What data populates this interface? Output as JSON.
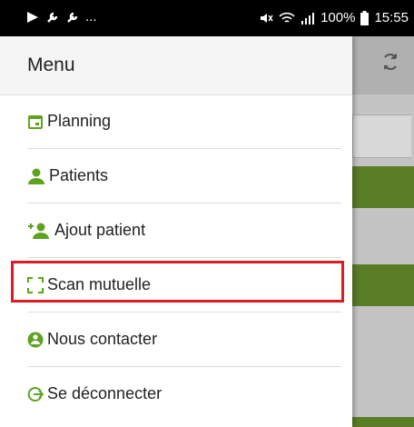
{
  "status_bar": {
    "time": "15:55",
    "battery": "100%",
    "left_overflow": "..."
  },
  "drawer": {
    "title": "Menu",
    "items": [
      {
        "label": "Planning",
        "icon": "calendar-icon"
      },
      {
        "label": "Patients",
        "icon": "person-icon"
      },
      {
        "label": "Ajout patient",
        "icon": "person-add-icon"
      },
      {
        "label": "Scan mutuelle",
        "icon": "scan-icon"
      },
      {
        "label": "Nous contacter",
        "icon": "info-icon"
      },
      {
        "label": "Se déconnecter",
        "icon": "logout-icon"
      }
    ]
  },
  "colors": {
    "accent": "#65a30d",
    "highlight": "#e11b22",
    "stripe": "#5a7e25"
  }
}
